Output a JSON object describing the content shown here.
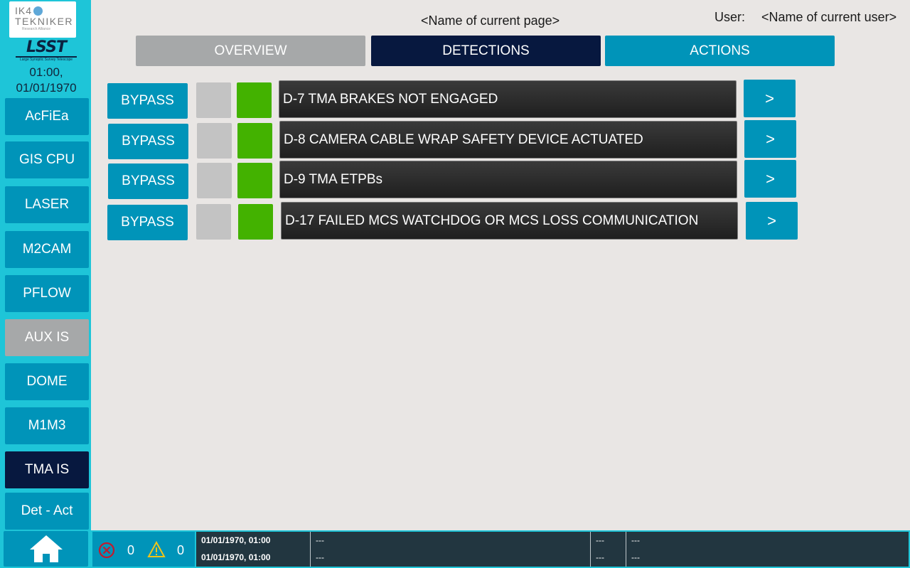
{
  "sidebar": {
    "logo_ik4": {
      "line1": "IK4",
      "line2": "TEKNIKER",
      "tagline": "Research Alliance"
    },
    "logo_lsst": {
      "word": "LSST",
      "tagline": "Large Synoptic Survey Telescope"
    },
    "clock_time": "01:00,",
    "clock_date": "01/01/1970",
    "items": [
      {
        "label": "AcFiEa",
        "state": "normal"
      },
      {
        "label": "GIS CPU",
        "state": "normal"
      },
      {
        "label": "LASER",
        "state": "normal"
      },
      {
        "label": "M2CAM",
        "state": "normal"
      },
      {
        "label": "PFLOW",
        "state": "normal"
      },
      {
        "label": "AUX IS",
        "state": "disabled"
      },
      {
        "label": "DOME",
        "state": "normal"
      },
      {
        "label": "M1M3",
        "state": "normal"
      },
      {
        "label": "TMA IS",
        "state": "active"
      },
      {
        "label": "Det - Act",
        "state": "normal"
      }
    ],
    "home_icon": "home-icon"
  },
  "header": {
    "page_name": "<Name of current page>",
    "user_label": "User:",
    "user_name": "<Name of current user>"
  },
  "tabs": [
    {
      "label": "OVERVIEW",
      "state": "disabled"
    },
    {
      "label": "DETECTIONS",
      "state": "active"
    },
    {
      "label": "ACTIONS",
      "state": "normal"
    }
  ],
  "detections": [
    {
      "bypass_label": "BYPASS",
      "label": "D-7 TMA BRAKES NOT ENGAGED",
      "status_grey": "off",
      "status_green": "ok",
      "arrow": ">"
    },
    {
      "bypass_label": "BYPASS",
      "label": "D-8 CAMERA CABLE WRAP SAFETY DEVICE ACTUATED",
      "status_grey": "off",
      "status_green": "ok",
      "arrow": ">"
    },
    {
      "bypass_label": "BYPASS",
      "label": "D-9 TMA ETPBs",
      "status_grey": "off",
      "status_green": "ok",
      "arrow": ">"
    },
    {
      "bypass_label": "BYPASS",
      "label": "D-17 FAILED MCS WATCHDOG OR MCS LOSS COMMUNICATION",
      "status_grey": "off",
      "status_green": "ok",
      "arrow": ">"
    }
  ],
  "footer": {
    "alarm_count": "0",
    "warning_count": "0",
    "alarm_icon": "error-circle-icon",
    "warning_icon": "warning-triangle-icon",
    "log": [
      {
        "timestamp": "01/01/1970, 01:00",
        "message": "---",
        "c3": "---",
        "c4": "---"
      },
      {
        "timestamp": "01/01/1970, 01:00",
        "message": "---",
        "c3": "---",
        "c4": "---"
      }
    ]
  },
  "colors": {
    "accent": "#0094b9",
    "active": "#07183f",
    "disabled": "#a6a8a9",
    "sidebar": "#1ec5d8",
    "ok_green": "#43b200",
    "background": "#e9e6e4"
  }
}
